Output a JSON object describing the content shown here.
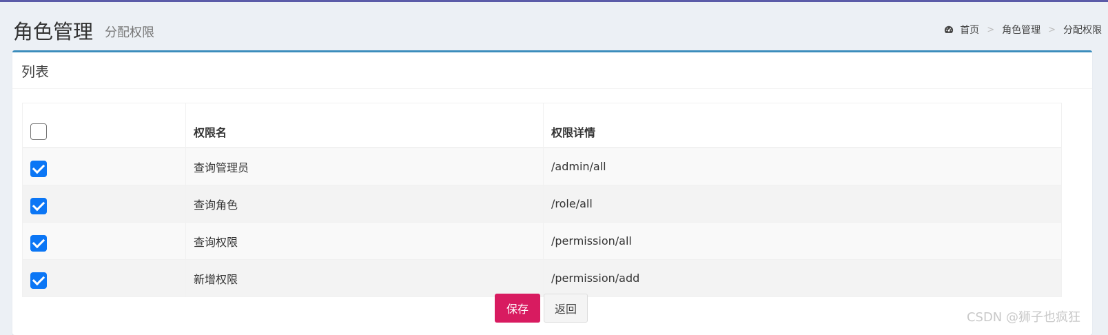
{
  "header": {
    "title": "角色管理",
    "subtitle": "分配权限",
    "breadcrumb": [
      "首页",
      "角色管理",
      "分配权限"
    ],
    "breadcrumb_sep": ">"
  },
  "box": {
    "title": "列表"
  },
  "table": {
    "columns": [
      "",
      "权限名",
      "权限详情"
    ],
    "rows": [
      {
        "checked": true,
        "name": "查询管理员",
        "detail": "/admin/all"
      },
      {
        "checked": true,
        "name": "查询角色",
        "detail": "/role/all"
      },
      {
        "checked": true,
        "name": "查询权限",
        "detail": "/permission/all"
      },
      {
        "checked": true,
        "name": "新增权限",
        "detail": "/permission/add"
      }
    ]
  },
  "actions": {
    "save_label": "保存",
    "back_label": "返回"
  },
  "watermark": "CSDN @狮子也疯狂",
  "colors": {
    "accent": "#3c8dbc",
    "save": "#d81b60",
    "checkbox": "#0b76f5"
  }
}
